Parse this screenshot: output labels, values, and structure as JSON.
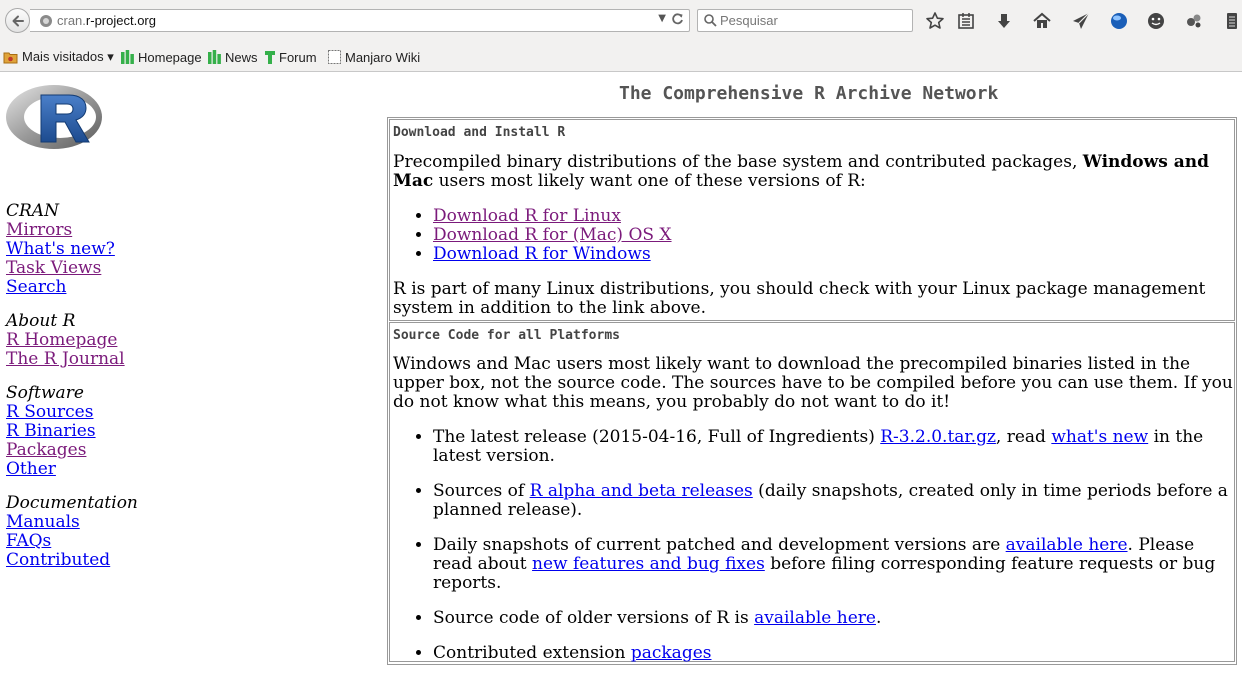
{
  "browser": {
    "url_host_prefix": "cran.",
    "url_host_domain": "r-project.org",
    "search_placeholder": "Pesquisar",
    "url_dropdown_glyph": "▼",
    "reload_glyph": "C",
    "bookmarks": [
      {
        "label": "Mais visitados ▾",
        "icon": "folder-icon"
      },
      {
        "label": "Homepage",
        "icon": "bookmark-bars-icon"
      },
      {
        "label": "News",
        "icon": "bookmark-bars-icon"
      },
      {
        "label": "Forum",
        "icon": "bookmark-bars-icon"
      },
      {
        "label": "Manjaro Wiki",
        "icon": "blank-page-icon"
      }
    ],
    "toolbar_icons": [
      "star-icon",
      "reading-list-icon",
      "download-icon",
      "home-icon",
      "send-icon",
      "blue-globe-addon-icon",
      "smiley-addon-icon",
      "puzzle-addon-icon",
      "menu-icon"
    ]
  },
  "page": {
    "title": "The Comprehensive R Archive Network",
    "sidebar": {
      "groups": [
        {
          "heading": "CRAN",
          "links": [
            "Mirrors",
            "What's new?",
            "Task Views",
            "Search"
          ]
        },
        {
          "heading": "About R",
          "links": [
            "R Homepage",
            "The R Journal"
          ]
        },
        {
          "heading": "Software",
          "links": [
            "R Sources",
            "R Binaries",
            "Packages",
            "Other"
          ]
        },
        {
          "heading": "Documentation",
          "links": [
            "Manuals",
            "FAQs",
            "Contributed"
          ]
        }
      ]
    },
    "install": {
      "heading": "Download and Install R",
      "intro_pre": "Precompiled binary distributions of the base system and contributed packages, ",
      "intro_bold": "Windows and Mac",
      "intro_post": " users most likely want one of these versions of R:",
      "links": [
        "Download R for Linux",
        "Download R for (Mac) OS X",
        "Download R for Windows"
      ],
      "note": "R is part of many Linux distributions, you should check with your Linux package management system in addition to the link above."
    },
    "source": {
      "heading": "Source Code for all Platforms",
      "intro": "Windows and Mac users most likely want to download the precompiled binaries listed in the upper box, not the source code. The sources have to be compiled before you can use them. If you do not know what this means, you probably do not want to do it!",
      "item1_pre": "The latest release (2015-04-16, Full of Ingredients) ",
      "item1_link1": "R-3.2.0.tar.gz",
      "item1_mid": ", read ",
      "item1_link2": "what's new",
      "item1_post": " in the latest version.",
      "item2_pre": "Sources of ",
      "item2_link": "R alpha and beta releases",
      "item2_post": " (daily snapshots, created only in time periods before a planned release).",
      "item3_pre": "Daily snapshots of current patched and development versions are ",
      "item3_link1": "available here",
      "item3_mid": ". Please read about ",
      "item3_link2": "new features and bug fixes",
      "item3_post": " before filing corresponding feature requests or bug reports.",
      "item4_pre": "Source code of older versions of R is ",
      "item4_link": "available here",
      "item4_post": ".",
      "item5_pre": "Contributed extension ",
      "item5_link": "packages"
    }
  }
}
